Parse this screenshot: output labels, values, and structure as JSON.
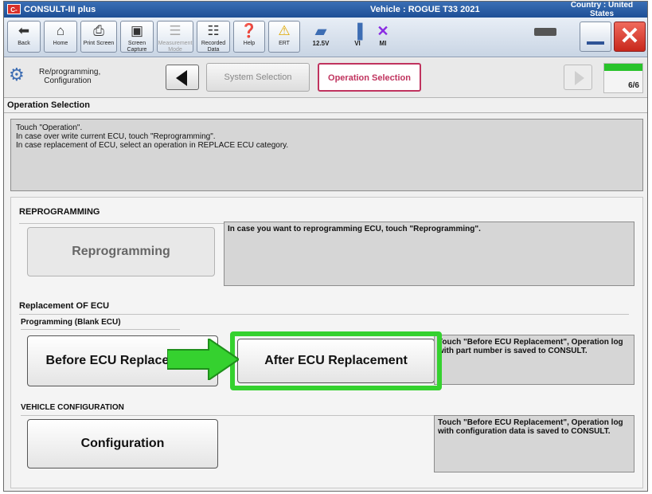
{
  "titlebar": {
    "logo": "C-III",
    "app_title": "CONSULT-III plus",
    "vehicle": "Vehicle : ROGUE T33 2021",
    "country": "Country : United States"
  },
  "toolbar": {
    "buttons": [
      {
        "label": "Back",
        "icon": "back-arrow-icon"
      },
      {
        "label": "Home",
        "icon": "home-icon"
      },
      {
        "label": "Print Screen",
        "icon": "printer-icon"
      },
      {
        "label": "Screen Capture",
        "icon": "camera-icon"
      },
      {
        "label": "Measurement Mode",
        "icon": "measurement-icon"
      },
      {
        "label": "Recorded Data",
        "icon": "recorded-data-icon"
      },
      {
        "label": "Help",
        "icon": "help-icon"
      },
      {
        "label": "ERT",
        "icon": "warning-icon"
      }
    ],
    "status": {
      "battery": "12.5V",
      "vi": "VI",
      "mi": "MI"
    }
  },
  "breadcrumb": {
    "reprog_label": "Re/programming, Configuration",
    "system_selection": "System Selection",
    "operation_selection": "Operation Selection",
    "step": "6/6",
    "progress_fraction": 1.0
  },
  "section": {
    "title": "Operation Selection"
  },
  "instructions": {
    "lines": [
      "Touch \"Operation\".",
      "In case over write current ECU, touch \"Reprogramming\".",
      "In case replacement of ECU, select an operation in REPLACE ECU category."
    ]
  },
  "reprogramming": {
    "heading": "REPROGRAMMING",
    "button": "Reprogramming",
    "description": "In case you want to reprogramming ECU, touch \"Reprogramming\"."
  },
  "replacement": {
    "heading": "Replacement OF ECU",
    "subheading": "Programming (Blank ECU)",
    "before_button": "Before ECU Replacement",
    "after_button": "After ECU Replacement",
    "description": "Touch \"Before ECU Replacement\", Operation log with part number is saved to CONSULT."
  },
  "configuration": {
    "heading": "VEHICLE CONFIGURATION",
    "button": "Configuration",
    "description": "Touch \"Before ECU Replacement\", Operation log with configuration data is saved to CONSULT."
  },
  "colors": {
    "highlight": "#35d12f",
    "active_tab": "#c0335e",
    "title_bar": "#1e4f96"
  }
}
